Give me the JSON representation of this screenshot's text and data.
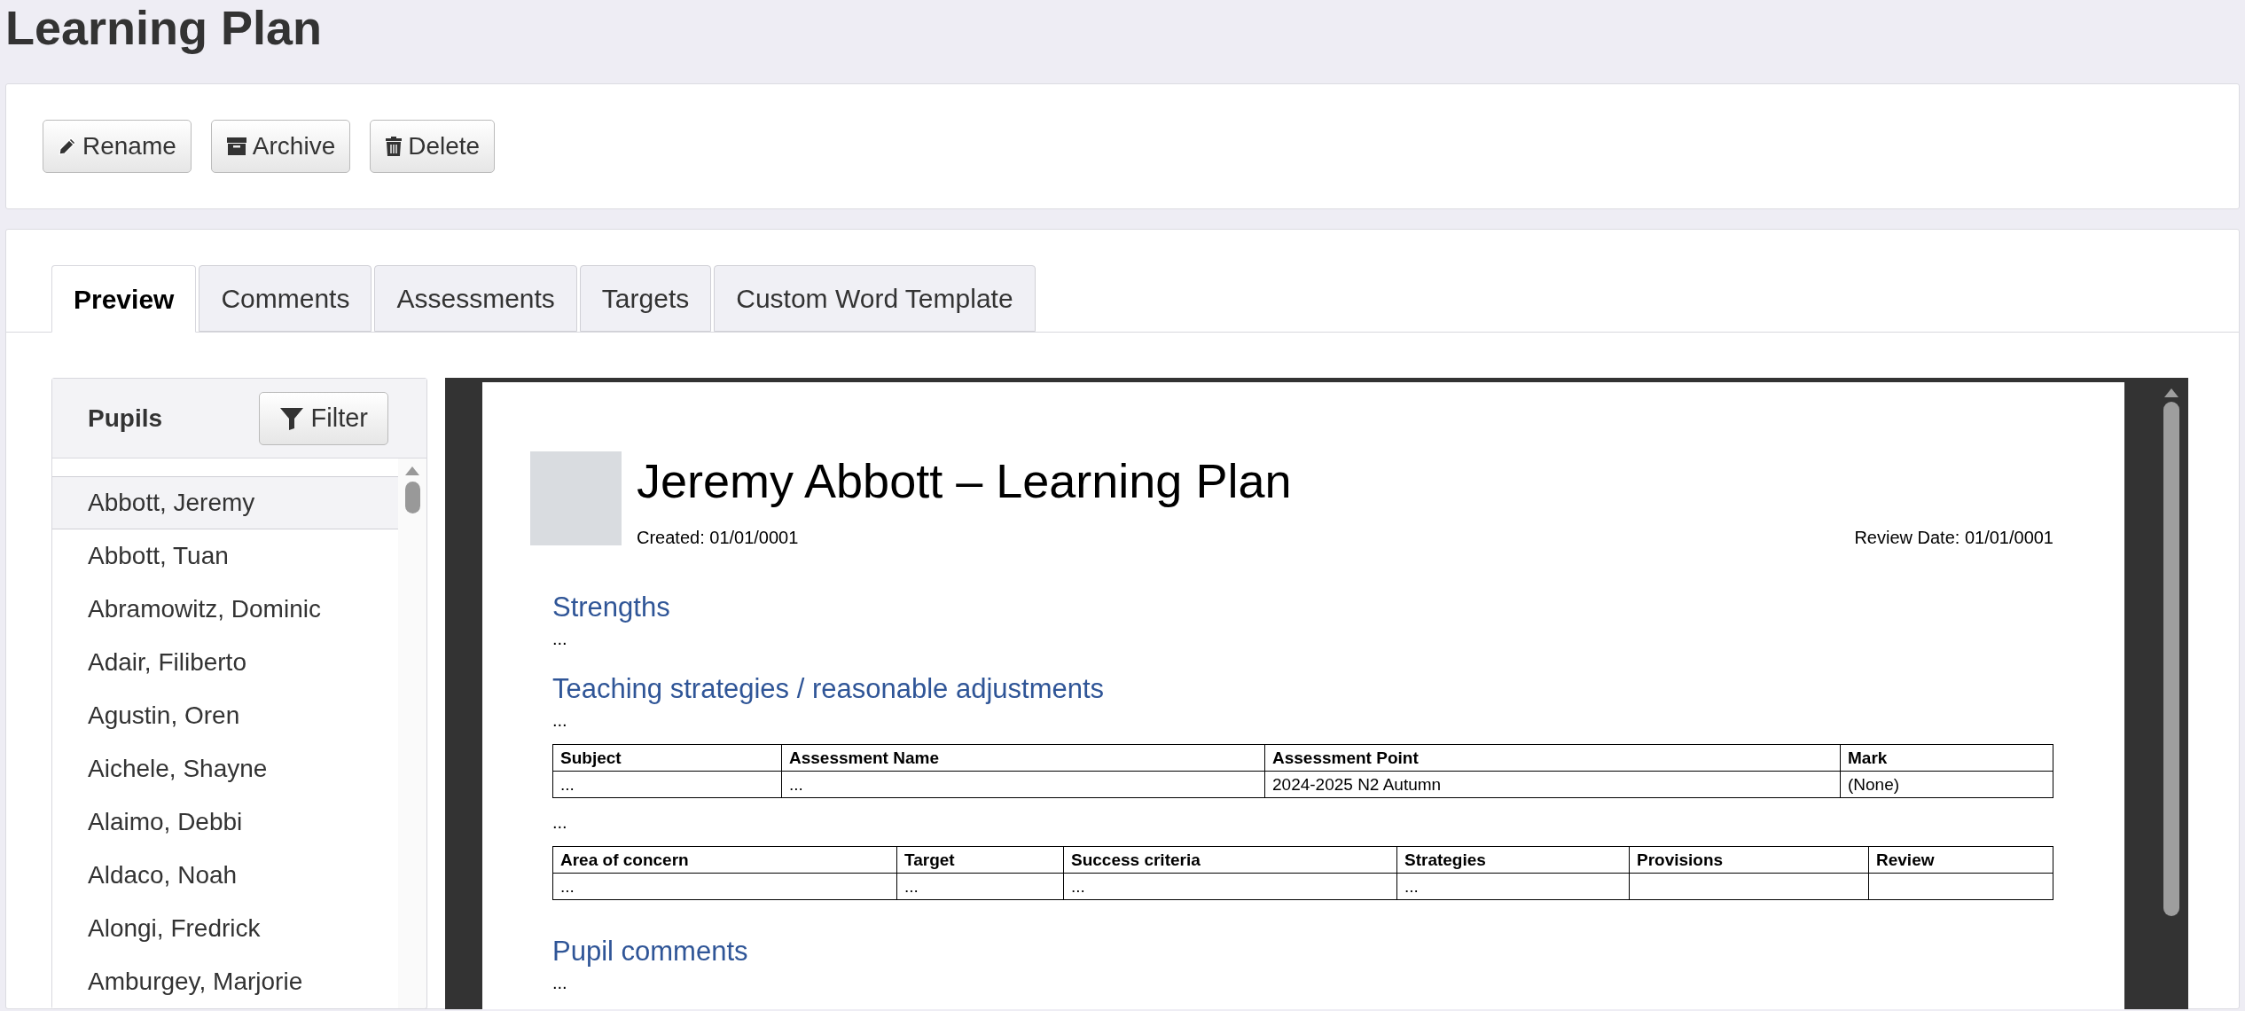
{
  "page_title": "Learning Plan",
  "actions": [
    {
      "kind": "rename",
      "label": "Rename"
    },
    {
      "kind": "archive",
      "label": "Archive"
    },
    {
      "kind": "delete",
      "label": "Delete"
    }
  ],
  "tabs": [
    {
      "label": "Preview",
      "selected": true
    },
    {
      "label": "Comments",
      "selected": false
    },
    {
      "label": "Assessments",
      "selected": false
    },
    {
      "label": "Targets",
      "selected": false
    },
    {
      "label": "Custom Word Template",
      "selected": false
    }
  ],
  "pupils": {
    "title": "Pupils",
    "filter_label": "Filter",
    "items": [
      {
        "name": "Abbott, Jeremy",
        "selected": true
      },
      {
        "name": "Abbott, Tuan",
        "selected": false
      },
      {
        "name": "Abramowitz, Dominic",
        "selected": false
      },
      {
        "name": "Adair, Filiberto",
        "selected": false
      },
      {
        "name": "Agustin, Oren",
        "selected": false
      },
      {
        "name": "Aichele, Shayne",
        "selected": false
      },
      {
        "name": "Alaimo, Debbi",
        "selected": false
      },
      {
        "name": "Aldaco, Noah",
        "selected": false
      },
      {
        "name": "Alongi, Fredrick",
        "selected": false
      },
      {
        "name": "Amburgey, Marjorie",
        "selected": false
      }
    ]
  },
  "document": {
    "title": "Jeremy Abbott – Learning Plan",
    "created": "Created: 01/01/0001",
    "review_date": "Review Date: 01/01/0001",
    "blocks": [
      {
        "kind": "heading",
        "text": "Strengths"
      },
      {
        "kind": "text",
        "text": "..."
      },
      {
        "kind": "heading",
        "text": "Teaching strategies / reasonable adjustments"
      },
      {
        "kind": "text",
        "text": "..."
      },
      {
        "kind": "table",
        "columns": [
          "Subject",
          "Assessment Name",
          "Assessment Point",
          "Mark"
        ],
        "rows": [
          [
            "...",
            "...",
            "2024-2025 N2 Autumn",
            "(None)"
          ]
        ]
      },
      {
        "kind": "text",
        "text": "..."
      },
      {
        "kind": "table",
        "columns": [
          "Area of concern",
          "Target",
          "Success criteria",
          "Strategies",
          "Provisions",
          "Review"
        ],
        "rows": [
          [
            "...",
            "...",
            "...",
            "..."
          ]
        ]
      },
      {
        "kind": "heading",
        "text": "Pupil comments"
      },
      {
        "kind": "text",
        "text": "..."
      }
    ]
  }
}
